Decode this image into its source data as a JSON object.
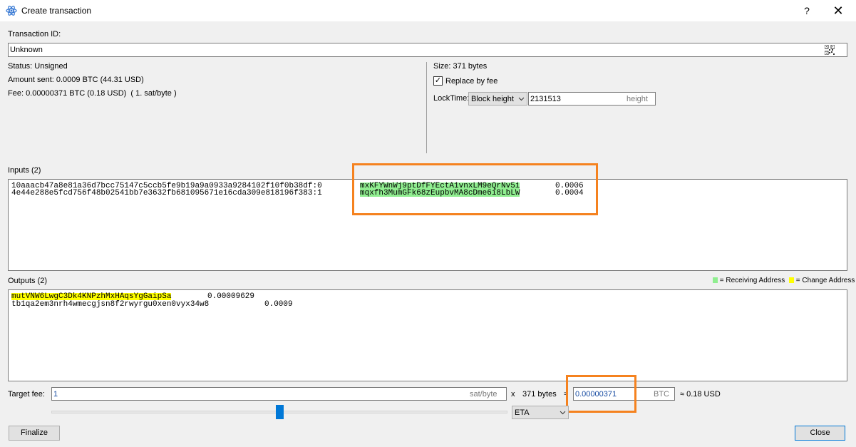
{
  "window": {
    "title": "Create transaction",
    "help": "?",
    "close": "✕"
  },
  "txid": {
    "label": "Transaction ID:",
    "value": "Unknown"
  },
  "status": "Status: Unsigned",
  "amount_sent": "Amount sent: 0.0009 BTC (44.31 USD)",
  "fee": "Fee: 0.00000371 BTC (0.18 USD)  ( 1. sat/byte )",
  "size": "Size: 371 bytes",
  "rbf": {
    "label": "Replace by fee",
    "checked": true
  },
  "locktime": {
    "label": "LockTime:",
    "type": "Block height",
    "value": "2131513",
    "unit": "height"
  },
  "inputs": {
    "label": "Inputs (2)",
    "rows": [
      {
        "prevout": "10aaacb47a8e81a36d7bcc75147c5ccb5fe9b19a9a0933a9284102f10f0b38df:0",
        "address": "mxKFYWnWj9ptDfFYEctA1vnxLM9eQrNv5i",
        "amount": "0.0006"
      },
      {
        "prevout": "4e44e288e5fcd756f48b02541bb7e3632fb681095671e16cda309e818196f383:1",
        "address": "mqxfh3MumGFk68zEupbvMA8cDme6i8LbLW",
        "amount": "0.0004"
      }
    ]
  },
  "outputs": {
    "label": "Outputs (2)",
    "legend_receiving": "= Receiving Address",
    "legend_change": "= Change Address",
    "rows": [
      {
        "address": "mutVNW6LwgC3Dk4KNPzhMxHAqsYgGaipSa",
        "amount": "0.00009629",
        "kind": "change"
      },
      {
        "address": "tb1qa2em3nrh4wmecgjsn8f2rwyrgu0xen0vyx34w8",
        "amount": "0.0009",
        "kind": "none"
      }
    ]
  },
  "target_fee": {
    "label": "Target fee:",
    "value": "1",
    "unit": "sat/byte",
    "times": "x",
    "bytes": "371 bytes",
    "equals": "=",
    "btc_value": "0.00000371",
    "btc_unit": "BTC",
    "approx": "≈ 0.18 USD",
    "slider_position": 0.5,
    "eta_option": "ETA"
  },
  "buttons": {
    "finalize": "Finalize",
    "close": "Close"
  },
  "colors": {
    "receiving": "#90ee90",
    "change": "#ffff00",
    "annotation": "#f5821f",
    "accent": "#0078d7"
  }
}
